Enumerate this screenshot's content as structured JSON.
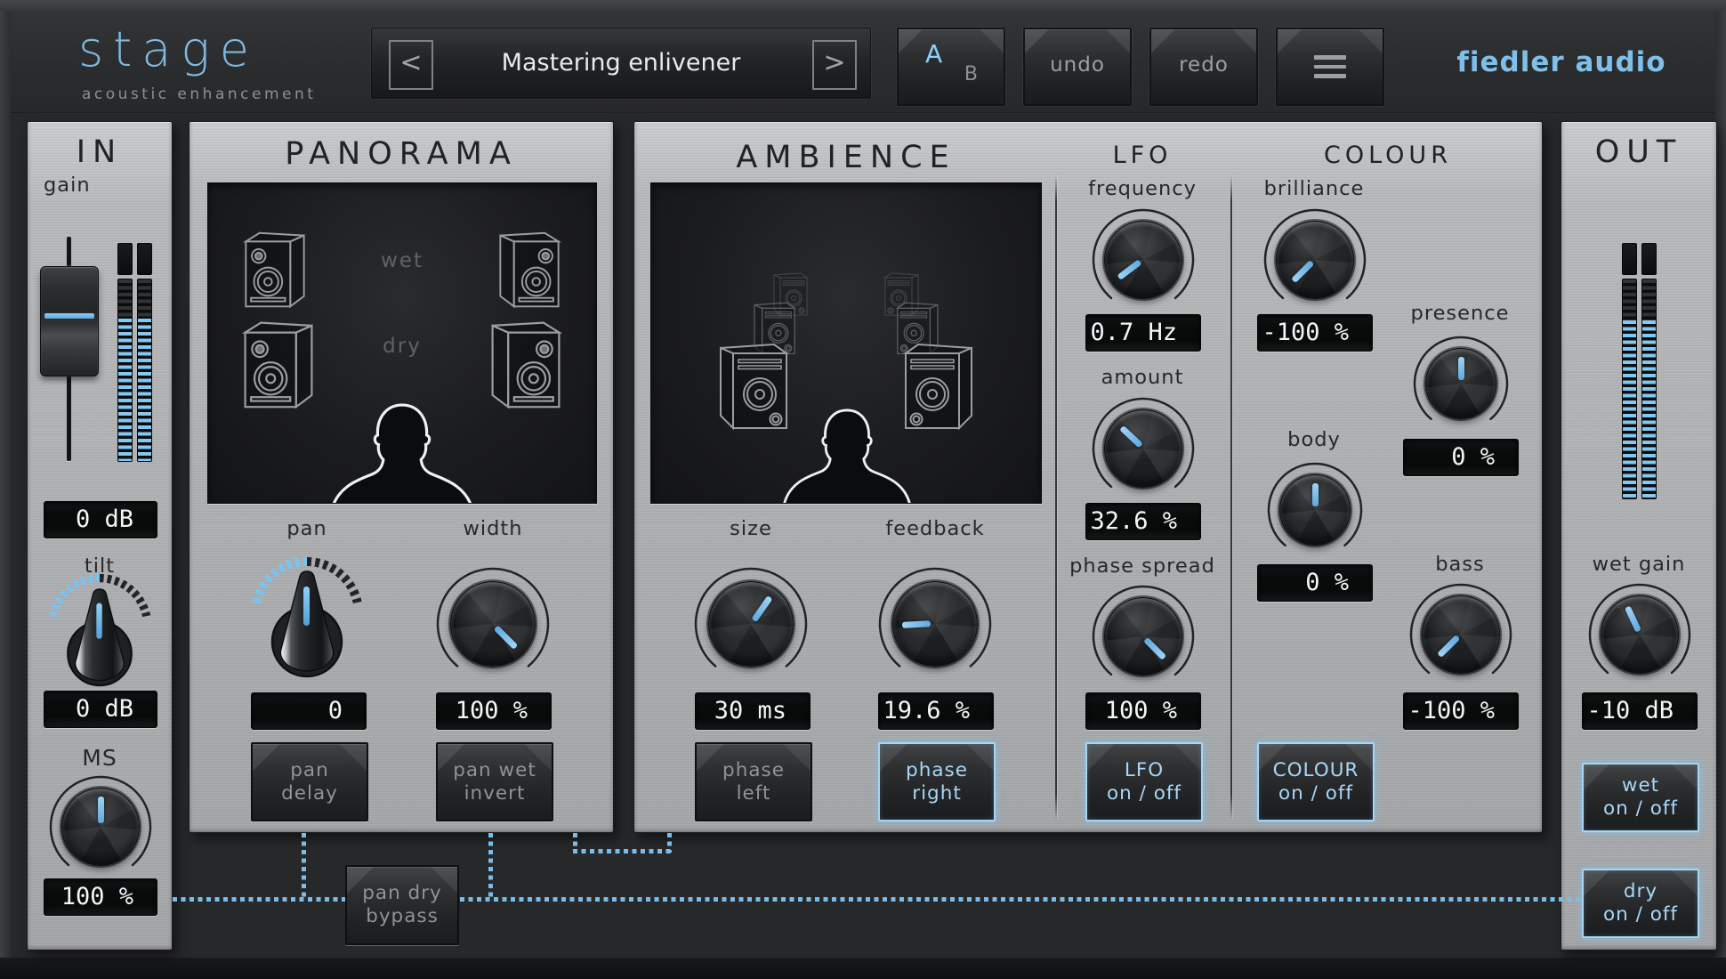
{
  "header": {
    "logo_title": "stage",
    "logo_subtitle": "acoustic enhancement",
    "brand": "fiedler audio",
    "preset_name": "Mastering enlivener",
    "prev_label": "<",
    "next_label": ">",
    "ab_a": "A",
    "ab_b": "B",
    "undo_label": "undo",
    "redo_label": "redo"
  },
  "in_panel": {
    "title": "IN",
    "gain_label": "gain",
    "gain_value": "0 dB",
    "tilt_label": "tilt",
    "tilt_value": "0 dB",
    "ms_label": "MS",
    "ms_value": "100 %"
  },
  "panorama": {
    "title": "PANORAMA",
    "wet_label": "wet",
    "dry_label": "dry",
    "pan_label": "pan",
    "pan_value": "0",
    "width_label": "width",
    "width_value": "100 %",
    "pan_delay": {
      "line1": "pan",
      "line2": "delay",
      "active": false
    },
    "pan_wet_invert": {
      "line1": "pan wet",
      "line2": "invert",
      "active": false
    }
  },
  "ambience": {
    "title": "AMBIENCE",
    "size_label": "size",
    "size_value": "30 ms",
    "feedback_label": "feedback",
    "feedback_value": "19.6 %",
    "phase_left": {
      "line1": "phase",
      "line2": "left",
      "active": false
    },
    "phase_right": {
      "line1": "phase",
      "line2": "right",
      "active": true
    }
  },
  "lfo": {
    "title": "LFO",
    "frequency_label": "frequency",
    "frequency_value": "0.7 Hz",
    "amount_label": "amount",
    "amount_value": "32.6 %",
    "phase_spread_label": "phase spread",
    "phase_spread_value": "100 %",
    "on_off": {
      "line1": "LFO",
      "line2": "on / off",
      "active": true
    }
  },
  "colour": {
    "title": "COLOUR",
    "brilliance_label": "brilliance",
    "brilliance_value": "-100 %",
    "presence_label": "presence",
    "presence_value": "0 %",
    "body_label": "body",
    "body_value": "0 %",
    "bass_label": "bass",
    "bass_value": "-100 %",
    "on_off": {
      "line1": "COLOUR",
      "line2": "on / off",
      "active": true
    }
  },
  "out_panel": {
    "title": "OUT",
    "wet_gain_label": "wet gain",
    "wet_gain_value": "-10 dB",
    "wet_on_off": {
      "line1": "wet",
      "line2": "on / off",
      "active": true
    },
    "dry_on_off": {
      "line1": "dry",
      "line2": "on / off",
      "active": true
    }
  },
  "bypass_button": {
    "line1": "pan dry",
    "line2": "bypass",
    "active": false
  },
  "colors": {
    "accent_blue": "#7cc2ee",
    "active_text": "#a9d7f6",
    "logo_blue": "#7fb9e2",
    "led_blue": "#83c9f2"
  }
}
